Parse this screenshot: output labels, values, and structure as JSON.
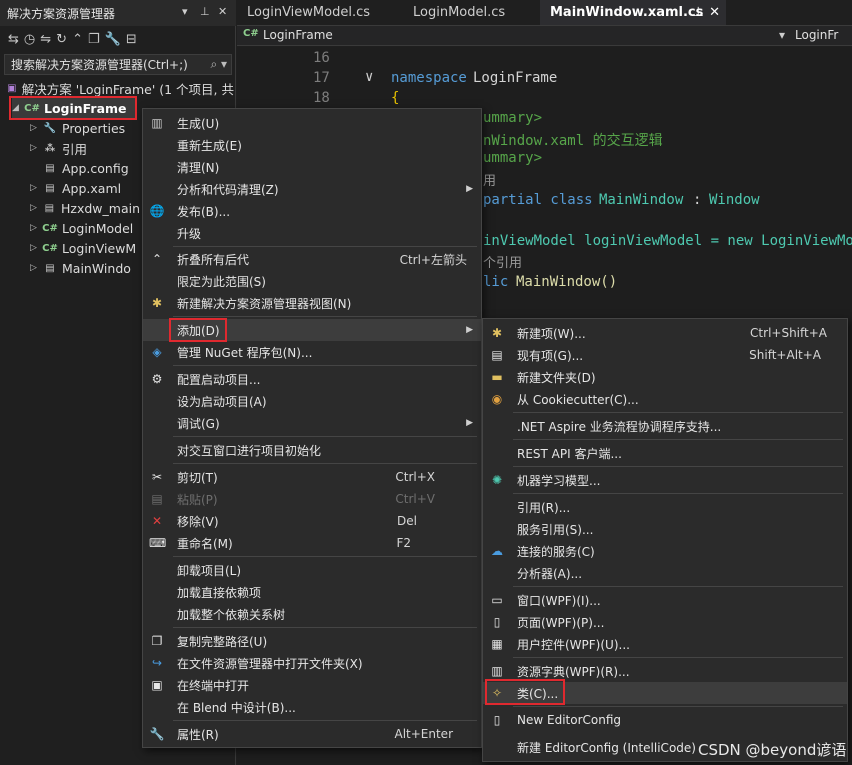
{
  "solution_explorer": {
    "title": "解决方案资源管理器",
    "pin": "▼ ꟼ ✕",
    "search_placeholder": "搜索解决方案资源管理器(Ctrl+;)",
    "solution_label": "解决方案 'LoginFrame' (1 个项目, 共",
    "project": "LoginFrame",
    "items": [
      "Properties",
      "引用",
      "App.config",
      "App.xaml",
      "Hzxdw_main",
      "LoginModel",
      "LoginViewM",
      "MainWindo"
    ]
  },
  "tabs": [
    "LoginViewModel.cs",
    "LoginModel.cs",
    "MainWindow.xaml.cs"
  ],
  "nav": {
    "left": "LoginFrame",
    "right": "LoginFr"
  },
  "code": {
    "lines": [
      "16",
      "17",
      "18"
    ],
    "ns_kw": "namespace",
    "ns_name": "LoginFrame",
    "brace": "{",
    "c1": "ummary>",
    "c2": "nWindow.xaml 的交互逻辑",
    "c3": "ummary>",
    "ref1": "用",
    "partial": "partial class",
    "cls": "MainWindow",
    "colon": ":",
    "base": "Window",
    "field": "inViewModel loginViewModel = new LoginViewMo",
    "ref2": "个引用",
    "ctor_kw": "lic",
    "ctor": "MainWindow()"
  },
  "context_menu": {
    "build": "生成(U)",
    "rebuild": "重新生成(E)",
    "clean": "清理(N)",
    "analyze": "分析和代码清理(Z)",
    "publish": "发布(B)...",
    "upgrade": "升级",
    "collapse": "折叠所有后代",
    "collapse_sc": "Ctrl+左箭头",
    "scope": "限定为此范围(S)",
    "newview": "新建解决方案资源管理器视图(N)",
    "add": "添加(D)",
    "nuget": "管理 NuGet 程序包(N)...",
    "startup_cfg": "配置启动项目...",
    "set_startup": "设为启动项目(A)",
    "debug": "调试(G)",
    "interactive": "对交互窗口进行项目初始化",
    "cut": "剪切(T)",
    "cut_sc": "Ctrl+X",
    "paste": "粘贴(P)",
    "paste_sc": "Ctrl+V",
    "remove": "移除(V)",
    "remove_sc": "Del",
    "rename": "重命名(M)",
    "rename_sc": "F2",
    "unload": "卸载项目(L)",
    "load_direct": "加载直接依赖项",
    "load_tree": "加载整个依赖关系树",
    "copy_path": "复制完整路径(U)",
    "open_folder": "在文件资源管理器中打开文件夹(X)",
    "terminal": "在终端中打开",
    "blend": "在 Blend 中设计(B)...",
    "props": "属性(R)",
    "props_sc": "Alt+Enter"
  },
  "add_menu": {
    "new_item": "新建项(W)...",
    "new_item_sc": "Ctrl+Shift+A",
    "existing": "现有项(G)...",
    "existing_sc": "Shift+Alt+A",
    "new_folder": "新建文件夹(D)",
    "cookie": "从 Cookiecutter(C)...",
    "aspire": ".NET Aspire 业务流程协调程序支持...",
    "rest": "REST API 客户端...",
    "ml": "机器学习模型...",
    "reference": "引用(R)...",
    "svc_ref": "服务引用(S)...",
    "connected": "连接的服务(C)",
    "analyzer": "分析器(A)...",
    "window": "窗口(WPF)(I)...",
    "page": "页面(WPF)(P)...",
    "usercontrol": "用户控件(WPF)(U)...",
    "resdict": "资源字典(WPF)(R)...",
    "class": "类(C)...",
    "editorconfig": "New EditorConfig",
    "editorconfig2": "新建 EditorConfig (IntelliCode)"
  },
  "watermark": "CSDN @beyond谚语",
  "colors": {
    "accent": "#e0292f",
    "menu_bg": "#2b2b2b",
    "cs_icon": "#8fd08f",
    "keyword": "#569cd6",
    "type": "#4ec9b0",
    "comment": "#57a64a"
  }
}
